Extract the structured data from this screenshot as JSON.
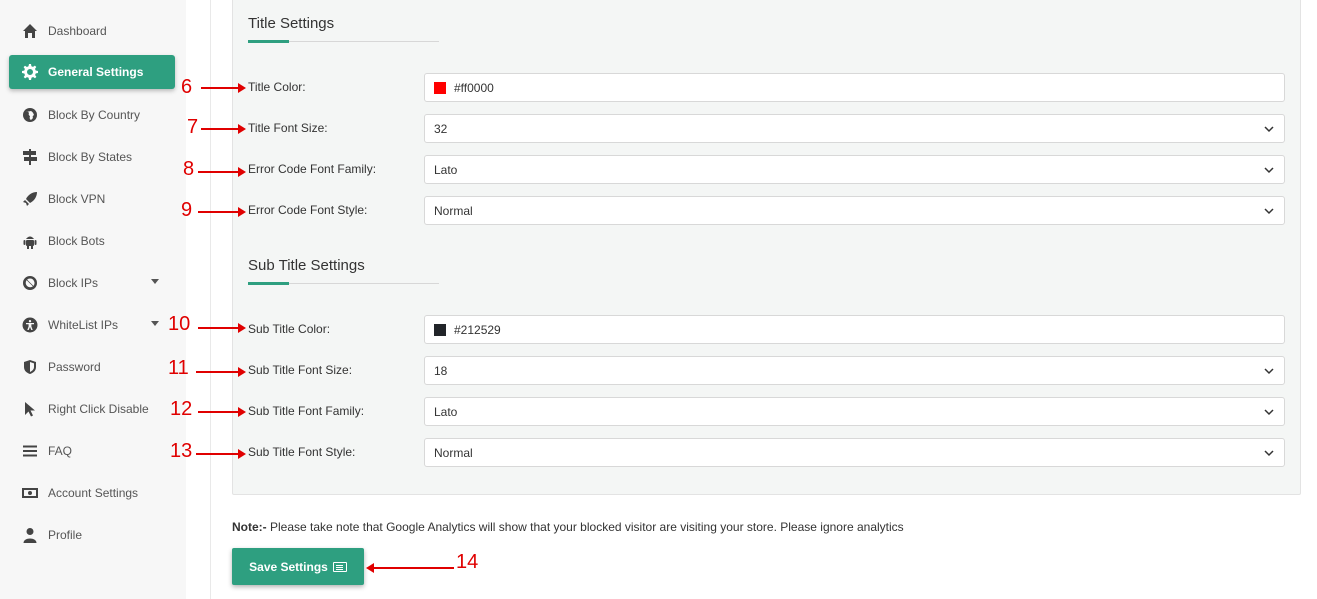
{
  "sidebar": {
    "items": [
      {
        "label": "Dashboard",
        "icon": "home-icon"
      },
      {
        "label": "General Settings",
        "icon": "gear-icon",
        "active": true
      },
      {
        "label": "Block By Country",
        "icon": "globe-icon"
      },
      {
        "label": "Block By States",
        "icon": "signpost-icon"
      },
      {
        "label": "Block VPN",
        "icon": "rocket-icon"
      },
      {
        "label": "Block Bots",
        "icon": "android-icon"
      },
      {
        "label": "Block IPs",
        "icon": "ban-icon",
        "expandable": true
      },
      {
        "label": "WhiteList IPs",
        "icon": "accessibility-icon",
        "expandable": true
      },
      {
        "label": "Password",
        "icon": "shield-icon"
      },
      {
        "label": "Right Click Disable",
        "icon": "cursor-icon"
      },
      {
        "label": "FAQ",
        "icon": "bars-icon"
      },
      {
        "label": "Account Settings",
        "icon": "money-icon"
      },
      {
        "label": "Profile",
        "icon": "user-icon"
      }
    ]
  },
  "title_settings": {
    "heading": "Title Settings",
    "fields": [
      {
        "label": "Title Color:",
        "value": "#ff0000",
        "type": "color",
        "swatch": "#ff0000"
      },
      {
        "label": "Title Font Size:",
        "value": "32",
        "type": "select"
      },
      {
        "label": "Error Code Font Family:",
        "value": "Lato",
        "type": "select"
      },
      {
        "label": "Error Code Font Style:",
        "value": "Normal",
        "type": "select"
      }
    ]
  },
  "subtitle_settings": {
    "heading": "Sub Title Settings",
    "fields": [
      {
        "label": "Sub Title Color:",
        "value": "#212529",
        "type": "color",
        "swatch": "#212529"
      },
      {
        "label": "Sub Title Font Size:",
        "value": "18",
        "type": "select"
      },
      {
        "label": "Sub Title Font Family:",
        "value": "Lato",
        "type": "select"
      },
      {
        "label": "Sub Title Font Style:",
        "value": "Normal",
        "type": "select"
      }
    ]
  },
  "annotations": [
    "6",
    "7",
    "8",
    "9",
    "10",
    "11",
    "12",
    "13",
    "14"
  ],
  "note": {
    "prefix": "Note:-",
    "text": " Please take note that Google Analytics will show that your blocked visitor are visiting your store. Please ignore analytics"
  },
  "save_button": {
    "label": "Save Settings",
    "icon": "save-icon"
  },
  "colors": {
    "accent": "#2e9f80",
    "annotation": "#e00000"
  }
}
